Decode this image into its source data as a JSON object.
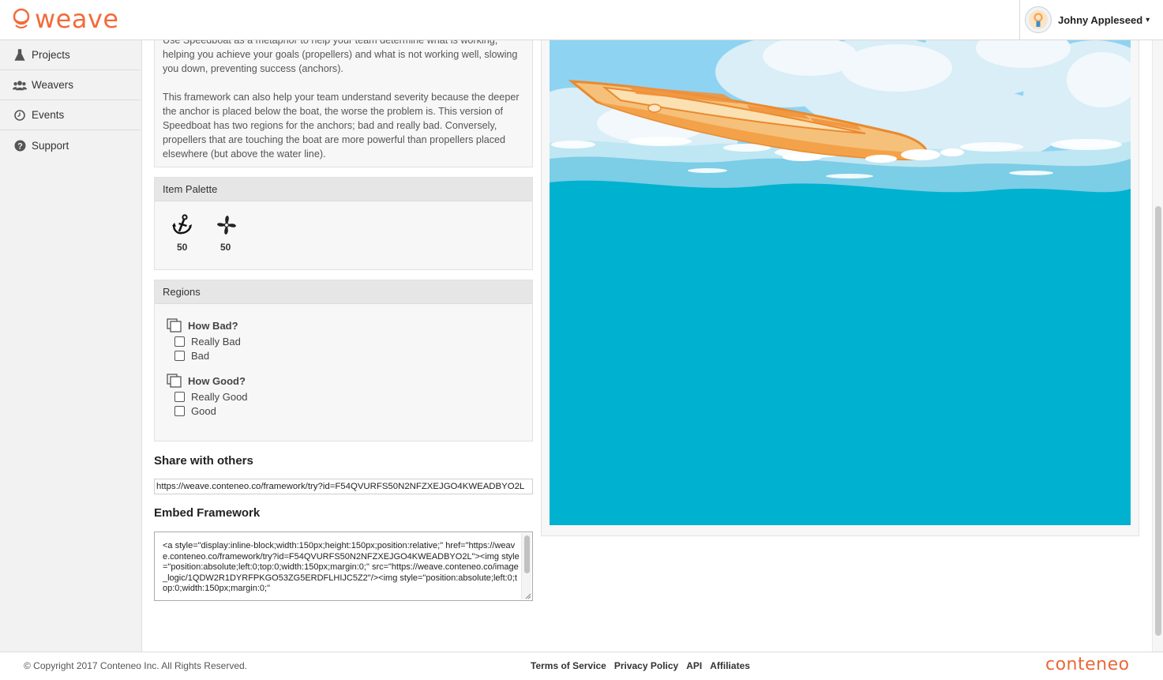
{
  "app": {
    "logo_text": "weave",
    "brand_color": "#f26b3a"
  },
  "user": {
    "name": "Johny Appleseed",
    "caret": "▾"
  },
  "sidebar": {
    "items": [
      {
        "label": "Projects",
        "icon": "flask-icon"
      },
      {
        "label": "Weavers",
        "icon": "users-icon"
      },
      {
        "label": "Events",
        "icon": "clock-icon"
      },
      {
        "label": "Support",
        "icon": "help-icon"
      }
    ]
  },
  "description": {
    "para1": "Use Speedboat as a metaphor to help your team determine what is working, helping you achieve your goals (propellers) and what is not working well, slowing you down, preventing success (anchors).",
    "para2": "This framework can also help your team understand severity because the deeper the anchor is placed below the boat, the worse the problem is. This version of Speedboat has two regions for the anchors; bad and really bad. Conversely, propellers that are touching the boat are more powerful than propellers placed elsewhere (but above the water line)."
  },
  "palette": {
    "title": "Item Palette",
    "items": [
      {
        "icon": "anchor-icon",
        "count": "50"
      },
      {
        "icon": "propeller-icon",
        "count": "50"
      }
    ]
  },
  "regions": {
    "title": "Regions",
    "groups": [
      {
        "label": "How Bad?",
        "items": [
          "Really Bad",
          "Bad"
        ]
      },
      {
        "label": "How Good?",
        "items": [
          "Really Good",
          "Good"
        ]
      }
    ]
  },
  "share": {
    "title": "Share with others",
    "url": "https://weave.conteneo.co/framework/try?id=F54QVURFS50N2NFZXEJGO4KWEADBYO2L"
  },
  "embed": {
    "title": "Embed Framework",
    "code": "<a style=\"display:inline-block;width:150px;height:150px;position:relative;\" href=\"https://weave.conteneo.co/framework/try?id=F54QVURFS50N2NFZXEJGO4KWEADBYO2L\"><img style=\"position:absolute;left:0;top:0;width:150px;margin:0;\" src=\"https://weave.conteneo.co/image_logic/1QDW2R1DYRFPKGO53ZG5ERDFLHIJC5Z2\"/><img style=\"position:absolute;left:0;top:0;width:150px;margin:0;\""
  },
  "footer": {
    "copyright": "© Copyright 2017 Conteneo Inc. All Rights Reserved.",
    "links": [
      "Terms of Service",
      "Privacy Policy",
      "API",
      "Affiliates"
    ],
    "brand": "conteneo"
  },
  "colors": {
    "sky": "#8fd3f2",
    "sea": "#00b2cf",
    "boat": "#f2a04a",
    "accent": "#f26b3a"
  }
}
